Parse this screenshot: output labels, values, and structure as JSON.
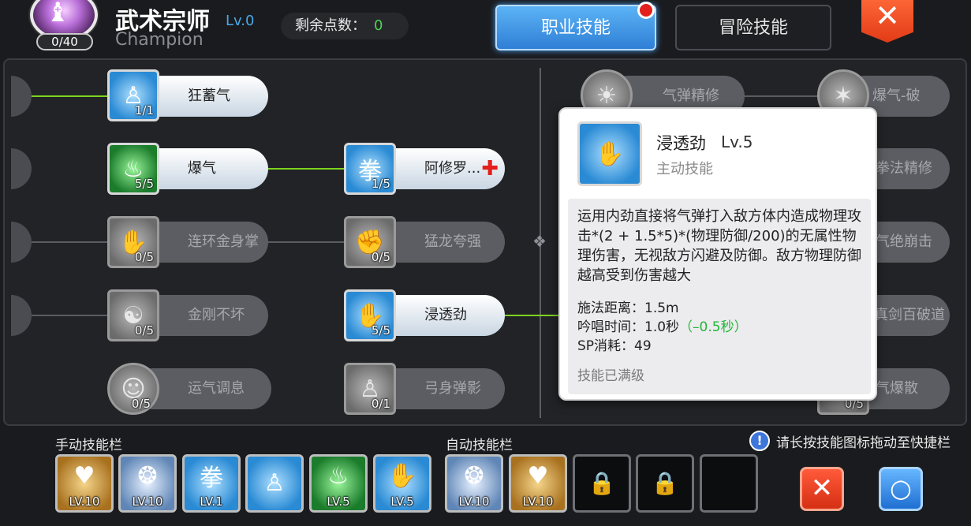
{
  "header": {
    "avatar_glyph": "♝",
    "skill_points_used": "0/40",
    "class_name": "武术宗师",
    "class_level": "Lv.0",
    "class_name_en": "Champion",
    "remaining_label": "剩余点数：",
    "remaining_value": "0"
  },
  "tabs": {
    "job": "职业技能",
    "adventure": "冒险技能"
  },
  "close_glyph": "✕",
  "tree": {
    "left": [
      {
        "label": "狂蓄气",
        "count": "1/1",
        "state": "active"
      },
      {
        "label": "爆气",
        "count": "5/5",
        "state": "active"
      },
      {
        "label": "连环金身掌",
        "count": "0/5",
        "state": "inactive"
      },
      {
        "label": "金刚不坏",
        "count": "0/5",
        "state": "inactive"
      },
      {
        "label": "运气调息",
        "count": "0/5",
        "state": "inactive"
      }
    ],
    "mid": [
      {
        "label": "阿修罗...",
        "count": "1/5",
        "state": "active",
        "glyph": "拳"
      },
      {
        "label": "猛龙夸强",
        "count": "0/5",
        "state": "inactive"
      },
      {
        "label": "浸透劲",
        "count": "5/5",
        "state": "active"
      },
      {
        "label": "弓身弹影",
        "count": "0/1",
        "state": "inactive"
      }
    ],
    "right_a": [
      {
        "label": "气弹精修"
      }
    ],
    "right_b": [
      {
        "label": "爆气-破"
      },
      {
        "label": "拳法精修"
      },
      {
        "label": "气绝崩击"
      },
      {
        "label": "真剑百破道"
      },
      {
        "label": "气爆散",
        "count": "0/5"
      }
    ],
    "plus_glyph": "✚",
    "divider_glyph": "❖"
  },
  "tooltip": {
    "name": "浸透劲",
    "level": "Lv.5",
    "type": "主动技能",
    "description": "运用内劲直接将气弹打入敌方体内造成物理攻击*(2 + 1.5*5)*(物理防御/200)的无属性物理伤害，无视敌方闪避及防御。敌方物理防御越高受到伤害越大",
    "range_label": "施法距离：",
    "range_value": "1.5m",
    "cast_label": "吟唱时间：",
    "cast_value": "1.0秒",
    "cast_bonus": "（–0.5秒）",
    "sp_label": "SP消耗：",
    "sp_value": "49",
    "footer": "技能已满级"
  },
  "bottom": {
    "manual_label": "手动技能栏",
    "auto_label": "自动技能栏",
    "hint_icon": "!",
    "hint": "请长按技能图标拖动至快捷栏",
    "manual_slots": [
      {
        "level": "LV.10",
        "glyph": "♥",
        "style": "gold"
      },
      {
        "level": "LV.10",
        "glyph": "❂",
        "style": "silver"
      },
      {
        "level": "LV.1",
        "glyph": "拳",
        "style": "blue"
      },
      {
        "level": "",
        "glyph": "♙",
        "style": "blue"
      },
      {
        "level": "LV.5",
        "glyph": "♨",
        "style": "green"
      },
      {
        "level": "LV.5",
        "glyph": "✋",
        "style": "blue"
      }
    ],
    "auto_slots": [
      {
        "level": "LV.10",
        "glyph": "❂",
        "style": "silver"
      },
      {
        "level": "LV.10",
        "glyph": "♥",
        "style": "gold"
      }
    ],
    "lock_glyph": "🔒",
    "cancel_glyph": "✕",
    "confirm_glyph": "○"
  },
  "colors": {
    "accent_blue": "#2f7fd6",
    "active_line": "#7ed321",
    "close_red": "#e23b16",
    "bonus_green": "#21b837"
  }
}
